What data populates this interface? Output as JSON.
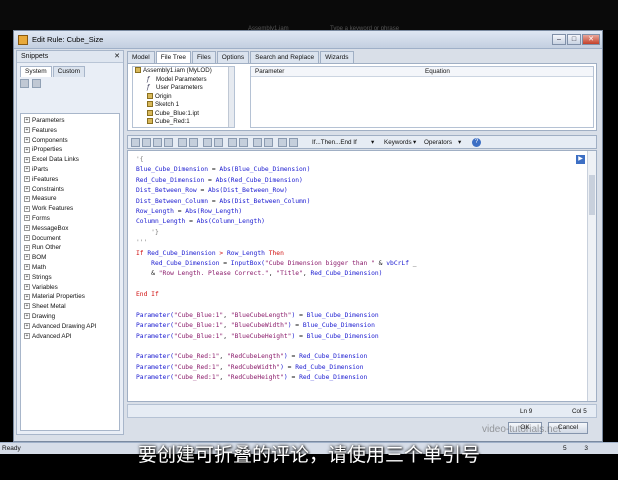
{
  "window": {
    "title": "Edit Rule: Cube_Size"
  },
  "top_ghost": {
    "left": "Assembly1.iam",
    "right": "Type a keyword or phrase"
  },
  "left_panel": {
    "title": "Snippets",
    "tabs": [
      "System",
      "Custom"
    ],
    "items": [
      "Parameters",
      "Features",
      "Components",
      "iProperties",
      "Excel Data Links",
      "iParts",
      "iFeatures",
      "Constraints",
      "Measure",
      "Work Features",
      "Forms",
      "MessageBox",
      "Document",
      "Run Other",
      "BOM",
      "Math",
      "Strings",
      "Variables",
      "Material Properties",
      "Sheet Metal",
      "Drawing",
      "Advanced Drawing API",
      "Advanced API"
    ]
  },
  "tabs": [
    "Model",
    "File Tree",
    "Files",
    "Options",
    "Search and Replace",
    "Wizards"
  ],
  "tree": [
    {
      "label": "Assembly1.iam (MyLOD)",
      "icon": "assembly-icon",
      "indent": 0
    },
    {
      "label": "Model Parameters",
      "icon": "fx-icon",
      "indent": 1
    },
    {
      "label": "User Parameters",
      "icon": "fx-icon",
      "indent": 1
    },
    {
      "label": "Origin",
      "icon": "folder-icon",
      "indent": 1
    },
    {
      "label": "Sketch 1",
      "icon": "sketch-icon",
      "indent": 1
    },
    {
      "label": "Cube_Blue:1.ipt",
      "icon": "part-icon",
      "indent": 1
    },
    {
      "label": "Cube_Red:1",
      "icon": "part-icon",
      "indent": 1
    }
  ],
  "params_header": {
    "parameter": "Parameter",
    "equation": "Equation"
  },
  "toolbar": {
    "ifthen": "If...Then...End If",
    "keywords": "Keywords",
    "operators": "Operators"
  },
  "code": [
    [
      [
        "c-cm",
        "'{"
      ]
    ],
    [
      [
        "c-var",
        "Blue_Cube_Dimension"
      ],
      [
        "c-pl",
        " = "
      ],
      [
        "c-var",
        "Abs(Blue_Cube_Dimension)"
      ]
    ],
    [
      [
        "c-var",
        "Red_Cube_Dimension"
      ],
      [
        "c-pl",
        " = "
      ],
      [
        "c-var",
        "Abs(Red_Cube_Dimension)"
      ]
    ],
    [
      [
        "c-var",
        "Dist_Between_Row"
      ],
      [
        "c-pl",
        " = "
      ],
      [
        "c-var",
        "Abs(Dist_Between_Row)"
      ]
    ],
    [
      [
        "c-var",
        "Dist_Between_Column"
      ],
      [
        "c-pl",
        " = "
      ],
      [
        "c-var",
        "Abs(Dist_Between_Column)"
      ]
    ],
    [
      [
        "c-var",
        "Row_Length"
      ],
      [
        "c-pl",
        " = "
      ],
      [
        "c-var",
        "Abs(Row_Length)"
      ]
    ],
    [
      [
        "c-var",
        "Column_Length"
      ],
      [
        "c-pl",
        " = "
      ],
      [
        "c-var",
        "Abs(Column_Length)"
      ]
    ],
    [
      [
        "c-cm",
        "    '}"
      ]
    ],
    [
      [
        "c-cm",
        "'''"
      ]
    ],
    [
      [
        "c-kw",
        "If "
      ],
      [
        "c-var",
        "Red_Cube_Dimension"
      ],
      [
        "c-kw",
        " > "
      ],
      [
        "c-var",
        "Row_Length"
      ],
      [
        "c-kw",
        " Then"
      ]
    ],
    [
      [
        "c-pl",
        "    "
      ],
      [
        "c-var",
        "Red_Cube_Dimension"
      ],
      [
        "c-pl",
        " = "
      ],
      [
        "c-var",
        "InputBox("
      ],
      [
        "c-str",
        "\"Cube Dimension bigger than \""
      ],
      [
        "c-pl",
        " & "
      ],
      [
        "c-var",
        "vbCrLf"
      ],
      [
        "c-pl",
        " _"
      ]
    ],
    [
      [
        "c-pl",
        "    & "
      ],
      [
        "c-str",
        "\"Row Length. Please Correct.\""
      ],
      [
        "c-pl",
        ", "
      ],
      [
        "c-str",
        "\"Title\""
      ],
      [
        "c-pl",
        ", "
      ],
      [
        "c-var",
        "Red_Cube_Dimension)"
      ]
    ],
    [
      [
        "c-pl",
        ""
      ]
    ],
    [
      [
        "c-kw",
        "End If"
      ]
    ],
    [
      [
        "c-pl",
        ""
      ]
    ],
    [
      [
        "c-var",
        "Parameter("
      ],
      [
        "c-str",
        "\"Cube_Blue:1\""
      ],
      [
        "c-pl",
        ", "
      ],
      [
        "c-str",
        "\"BlueCubeLength\""
      ],
      [
        "c-var",
        ")"
      ],
      [
        "c-pl",
        " = "
      ],
      [
        "c-var",
        "Blue_Cube_Dimension"
      ]
    ],
    [
      [
        "c-var",
        "Parameter("
      ],
      [
        "c-str",
        "\"Cube_Blue:1\""
      ],
      [
        "c-pl",
        ", "
      ],
      [
        "c-str",
        "\"BlueCubeWidth\""
      ],
      [
        "c-var",
        ")"
      ],
      [
        "c-pl",
        " = "
      ],
      [
        "c-var",
        "Blue_Cube_Dimension"
      ]
    ],
    [
      [
        "c-var",
        "Parameter("
      ],
      [
        "c-str",
        "\"Cube_Blue:1\""
      ],
      [
        "c-pl",
        ", "
      ],
      [
        "c-str",
        "\"BlueCubeHeight\""
      ],
      [
        "c-var",
        ")"
      ],
      [
        "c-pl",
        " = "
      ],
      [
        "c-var",
        "Blue_Cube_Dimension"
      ]
    ],
    [
      [
        "c-pl",
        ""
      ]
    ],
    [
      [
        "c-var",
        "Parameter("
      ],
      [
        "c-str",
        "\"Cube_Red:1\""
      ],
      [
        "c-pl",
        ", "
      ],
      [
        "c-str",
        "\"RedCubeLength\""
      ],
      [
        "c-var",
        ")"
      ],
      [
        "c-pl",
        " = "
      ],
      [
        "c-var",
        "Red_Cube_Dimension"
      ]
    ],
    [
      [
        "c-var",
        "Parameter("
      ],
      [
        "c-str",
        "\"Cube_Red:1\""
      ],
      [
        "c-pl",
        ", "
      ],
      [
        "c-str",
        "\"RedCubeWidth\""
      ],
      [
        "c-var",
        ")"
      ],
      [
        "c-pl",
        " = "
      ],
      [
        "c-var",
        "Red_Cube_Dimension"
      ]
    ],
    [
      [
        "c-var",
        "Parameter("
      ],
      [
        "c-str",
        "\"Cube_Red:1\""
      ],
      [
        "c-pl",
        ", "
      ],
      [
        "c-str",
        "\"RedCubeHeight\""
      ],
      [
        "c-var",
        ")"
      ],
      [
        "c-pl",
        " = "
      ],
      [
        "c-var",
        "Red_Cube_Dimension"
      ]
    ]
  ],
  "status": {
    "ln": "Ln 9",
    "col": "Col 5"
  },
  "buttons": {
    "ok": "OK",
    "cancel": "Cancel"
  },
  "app_status": {
    "ready": "Ready",
    "nums": "5   3"
  },
  "watermark": "video-tutorials.net",
  "subtitle": "要创建可折叠的评论，请使用三个单引号"
}
